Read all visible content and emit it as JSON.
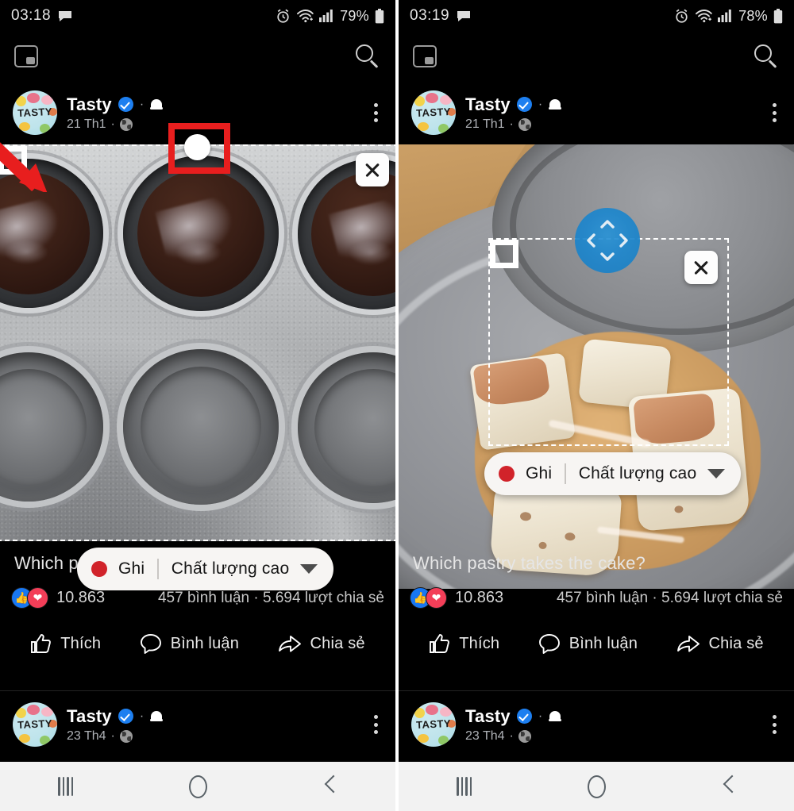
{
  "panels": [
    {
      "id": "left",
      "status_bar": {
        "clock": "03:18",
        "battery_percent": "79%",
        "icons": [
          "message-icon",
          "alarm-icon",
          "wifi-plus-icon",
          "signal-icon",
          "battery-icon"
        ]
      },
      "app_bar": {
        "pip_icon": "picture-in-picture-icon",
        "search_icon": "search-icon"
      },
      "post": {
        "author": "Tasty",
        "verified": true,
        "avatar_label": "TASTY",
        "date": "21 Th1",
        "audience_icon": "globe-icon",
        "bell_icon": "bell-icon",
        "menu_icon": "kebab-menu-icon",
        "caption": "Which pastry takes the cake?",
        "reactions_count": "10.863",
        "engagement": "457 bình luận · 5.694 lượt chia sẻ",
        "actions": [
          {
            "label": "Thích",
            "icon": "thumbs-up-icon"
          },
          {
            "label": "Bình luận",
            "icon": "comment-bubble-icon"
          },
          {
            "label": "Chia sẻ",
            "icon": "share-arrow-icon"
          }
        ]
      },
      "second_post": {
        "author": "Tasty",
        "verified": true,
        "avatar_label": "TASTY",
        "date": "23 Th4",
        "audience_icon": "globe-icon"
      },
      "recorder": {
        "record_label": "Ghi",
        "quality_label": "Chất lượng cao",
        "record_dot_color": "#d1232a",
        "caret_icon": "chevron-down-icon",
        "close_icon": "close-icon"
      },
      "annotation": {
        "arrow_color": "#e81e1e",
        "box_color": "#e81e1e",
        "handle_icon": "resize-handle-dot"
      },
      "nav_bar": {
        "recents": "recents-icon",
        "home": "home-icon",
        "back": "back-icon"
      }
    },
    {
      "id": "right",
      "status_bar": {
        "clock": "03:19",
        "battery_percent": "78%",
        "icons": [
          "message-icon",
          "alarm-icon",
          "wifi-plus-icon",
          "signal-icon",
          "battery-icon"
        ]
      },
      "app_bar": {
        "pip_icon": "picture-in-picture-icon",
        "search_icon": "search-icon"
      },
      "post": {
        "author": "Tasty",
        "verified": true,
        "avatar_label": "TASTY",
        "date": "21 Th1",
        "audience_icon": "globe-icon",
        "bell_icon": "bell-icon",
        "menu_icon": "kebab-menu-icon",
        "caption": "Which pastry takes the cake?",
        "reactions_count": "10.863",
        "engagement": "457 bình luận · 5.694 lượt chia sẻ",
        "actions": [
          {
            "label": "Thích",
            "icon": "thumbs-up-icon"
          },
          {
            "label": "Bình luận",
            "icon": "comment-bubble-icon"
          },
          {
            "label": "Chia sẻ",
            "icon": "share-arrow-icon"
          }
        ]
      },
      "second_post": {
        "author": "Tasty",
        "verified": true,
        "avatar_label": "TASTY",
        "date": "23 Th4",
        "audience_icon": "globe-icon"
      },
      "recorder": {
        "record_label": "Ghi",
        "quality_label": "Chất lượng cao",
        "record_dot_color": "#d1232a",
        "caret_icon": "chevron-down-icon",
        "close_icon": "close-icon",
        "move_handle_icon": "move-four-arrows-handle",
        "move_handle_color": "#1e87cd"
      },
      "nav_bar": {
        "recents": "recents-icon",
        "home": "home-icon",
        "back": "back-icon"
      }
    }
  ]
}
